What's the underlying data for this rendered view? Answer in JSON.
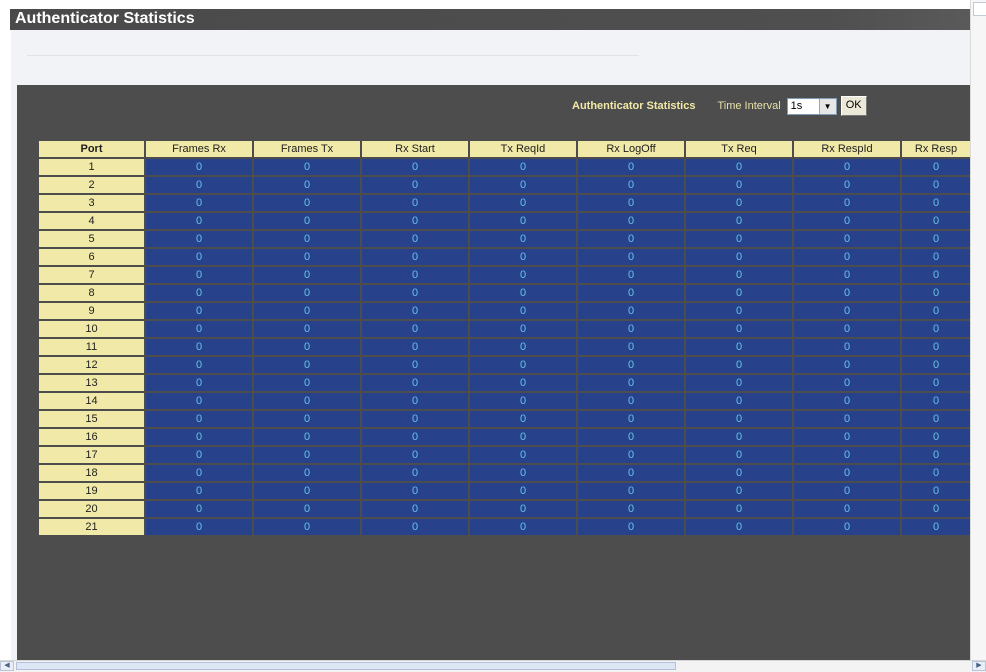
{
  "page": {
    "title": "Authenticator Statistics"
  },
  "toolbar": {
    "label": "Authenticator Statistics",
    "interval_label": "Time Interval",
    "interval_value": "1s",
    "ok_label": "OK"
  },
  "table": {
    "headers": [
      "Port",
      "Frames Rx",
      "Frames Tx",
      "Rx Start",
      "Tx ReqId",
      "Rx LogOff",
      "Tx Req",
      "Rx RespId",
      "Rx Resp"
    ],
    "rows": [
      [
        "1",
        "0",
        "0",
        "0",
        "0",
        "0",
        "0",
        "0",
        "0"
      ],
      [
        "2",
        "0",
        "0",
        "0",
        "0",
        "0",
        "0",
        "0",
        "0"
      ],
      [
        "3",
        "0",
        "0",
        "0",
        "0",
        "0",
        "0",
        "0",
        "0"
      ],
      [
        "4",
        "0",
        "0",
        "0",
        "0",
        "0",
        "0",
        "0",
        "0"
      ],
      [
        "5",
        "0",
        "0",
        "0",
        "0",
        "0",
        "0",
        "0",
        "0"
      ],
      [
        "6",
        "0",
        "0",
        "0",
        "0",
        "0",
        "0",
        "0",
        "0"
      ],
      [
        "7",
        "0",
        "0",
        "0",
        "0",
        "0",
        "0",
        "0",
        "0"
      ],
      [
        "8",
        "0",
        "0",
        "0",
        "0",
        "0",
        "0",
        "0",
        "0"
      ],
      [
        "9",
        "0",
        "0",
        "0",
        "0",
        "0",
        "0",
        "0",
        "0"
      ],
      [
        "10",
        "0",
        "0",
        "0",
        "0",
        "0",
        "0",
        "0",
        "0"
      ],
      [
        "11",
        "0",
        "0",
        "0",
        "0",
        "0",
        "0",
        "0",
        "0"
      ],
      [
        "12",
        "0",
        "0",
        "0",
        "0",
        "0",
        "0",
        "0",
        "0"
      ],
      [
        "13",
        "0",
        "0",
        "0",
        "0",
        "0",
        "0",
        "0",
        "0"
      ],
      [
        "14",
        "0",
        "0",
        "0",
        "0",
        "0",
        "0",
        "0",
        "0"
      ],
      [
        "15",
        "0",
        "0",
        "0",
        "0",
        "0",
        "0",
        "0",
        "0"
      ],
      [
        "16",
        "0",
        "0",
        "0",
        "0",
        "0",
        "0",
        "0",
        "0"
      ],
      [
        "17",
        "0",
        "0",
        "0",
        "0",
        "0",
        "0",
        "0",
        "0"
      ],
      [
        "18",
        "0",
        "0",
        "0",
        "0",
        "0",
        "0",
        "0",
        "0"
      ],
      [
        "19",
        "0",
        "0",
        "0",
        "0",
        "0",
        "0",
        "0",
        "0"
      ],
      [
        "20",
        "0",
        "0",
        "0",
        "0",
        "0",
        "0",
        "0",
        "0"
      ],
      [
        "21",
        "0",
        "0",
        "0",
        "0",
        "0",
        "0",
        "0",
        "0"
      ]
    ]
  },
  "colors": {
    "header_bg": "#f0e9a7",
    "value_bg": "#27428a",
    "value_text": "#66c2ea",
    "panel_bg": "#4d4d4d"
  },
  "icons": {
    "dropdown": "chevron-down-icon",
    "scroll_left": "arrow-left-icon",
    "scroll_right": "arrow-right-icon"
  }
}
